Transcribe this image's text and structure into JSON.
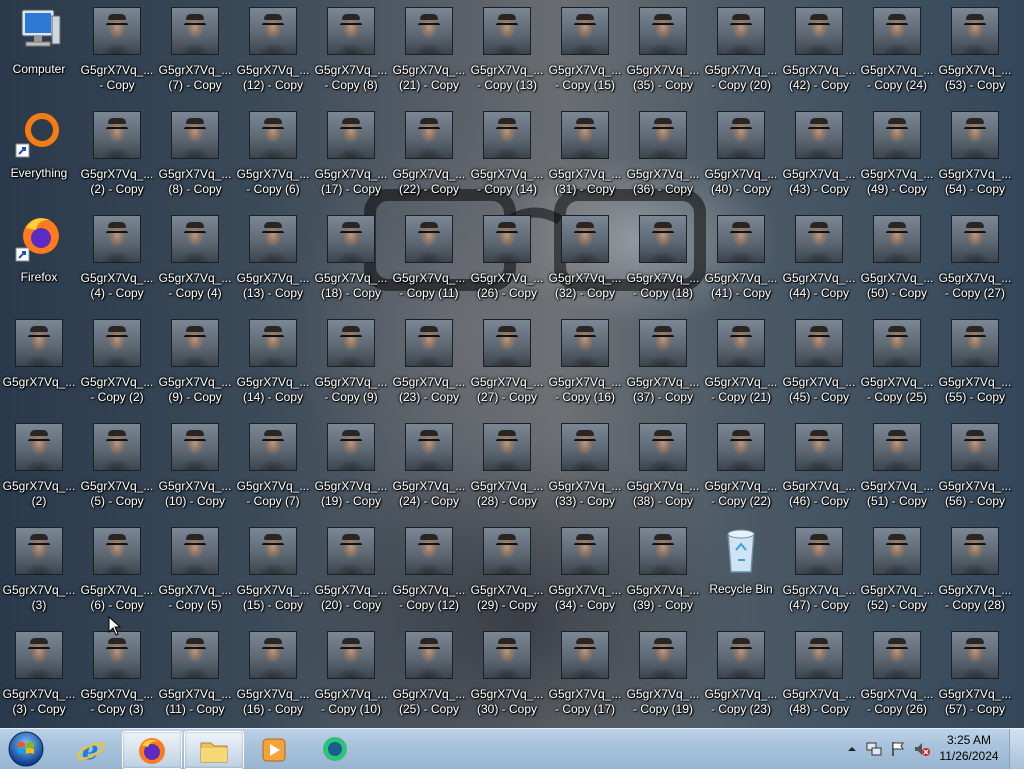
{
  "desktop": {
    "system_icons": [
      {
        "name": "computer",
        "label": "Computer",
        "col": 0,
        "row": 0
      },
      {
        "name": "everything",
        "label": "Everything",
        "col": 0,
        "row": 1
      },
      {
        "name": "firefox",
        "label": "Firefox",
        "col": 0,
        "row": 2
      },
      {
        "name": "recycle-bin",
        "label": "Recycle Bin",
        "col": 9,
        "row": 5
      }
    ],
    "file_icons": [
      {
        "col": 1,
        "row": 0,
        "l1": "G5grX7Vq_...",
        "l2": "- Copy"
      },
      {
        "col": 2,
        "row": 0,
        "l1": "G5grX7Vq_...",
        "l2": "(7) - Copy"
      },
      {
        "col": 3,
        "row": 0,
        "l1": "G5grX7Vq_...",
        "l2": "(12) - Copy"
      },
      {
        "col": 4,
        "row": 0,
        "l1": "G5grX7Vq_...",
        "l2": "- Copy (8)"
      },
      {
        "col": 5,
        "row": 0,
        "l1": "G5grX7Vq_...",
        "l2": "(21) - Copy"
      },
      {
        "col": 6,
        "row": 0,
        "l1": "G5grX7Vq_...",
        "l2": "- Copy (13)"
      },
      {
        "col": 7,
        "row": 0,
        "l1": "G5grX7Vq_...",
        "l2": "- Copy (15)"
      },
      {
        "col": 8,
        "row": 0,
        "l1": "G5grX7Vq_...",
        "l2": "(35) - Copy"
      },
      {
        "col": 9,
        "row": 0,
        "l1": "G5grX7Vq_...",
        "l2": "- Copy (20)"
      },
      {
        "col": 10,
        "row": 0,
        "l1": "G5grX7Vq_...",
        "l2": "(42) - Copy"
      },
      {
        "col": 11,
        "row": 0,
        "l1": "G5grX7Vq_...",
        "l2": "- Copy (24)"
      },
      {
        "col": 12,
        "row": 0,
        "l1": "G5grX7Vq_...",
        "l2": "(53) - Copy"
      },
      {
        "col": 1,
        "row": 1,
        "l1": "G5grX7Vq_...",
        "l2": "(2) - Copy"
      },
      {
        "col": 2,
        "row": 1,
        "l1": "G5grX7Vq_...",
        "l2": "(8) - Copy"
      },
      {
        "col": 3,
        "row": 1,
        "l1": "G5grX7Vq_...",
        "l2": "- Copy (6)"
      },
      {
        "col": 4,
        "row": 1,
        "l1": "G5grX7Vq_...",
        "l2": "(17) - Copy"
      },
      {
        "col": 5,
        "row": 1,
        "l1": "G5grX7Vq_...",
        "l2": "(22) - Copy"
      },
      {
        "col": 6,
        "row": 1,
        "l1": "G5grX7Vq_...",
        "l2": "- Copy (14)"
      },
      {
        "col": 7,
        "row": 1,
        "l1": "G5grX7Vq_...",
        "l2": "(31) - Copy"
      },
      {
        "col": 8,
        "row": 1,
        "l1": "G5grX7Vq_...",
        "l2": "(36) - Copy"
      },
      {
        "col": 9,
        "row": 1,
        "l1": "G5grX7Vq_...",
        "l2": "(40) - Copy"
      },
      {
        "col": 10,
        "row": 1,
        "l1": "G5grX7Vq_...",
        "l2": "(43) - Copy"
      },
      {
        "col": 11,
        "row": 1,
        "l1": "G5grX7Vq_...",
        "l2": "(49) - Copy"
      },
      {
        "col": 12,
        "row": 1,
        "l1": "G5grX7Vq_...",
        "l2": "(54) - Copy"
      },
      {
        "col": 1,
        "row": 2,
        "l1": "G5grX7Vq_...",
        "l2": "(4) - Copy"
      },
      {
        "col": 2,
        "row": 2,
        "l1": "G5grX7Vq_...",
        "l2": "- Copy (4)"
      },
      {
        "col": 3,
        "row": 2,
        "l1": "G5grX7Vq_...",
        "l2": "(13) - Copy"
      },
      {
        "col": 4,
        "row": 2,
        "l1": "G5grX7Vq_...",
        "l2": "(18) - Copy"
      },
      {
        "col": 5,
        "row": 2,
        "l1": "G5grX7Vq_...",
        "l2": "- Copy (11)"
      },
      {
        "col": 6,
        "row": 2,
        "l1": "G5grX7Vq_...",
        "l2": "(26) - Copy"
      },
      {
        "col": 7,
        "row": 2,
        "l1": "G5grX7Vq_...",
        "l2": "(32) - Copy"
      },
      {
        "col": 8,
        "row": 2,
        "l1": "G5grX7Vq_...",
        "l2": "- Copy (18)"
      },
      {
        "col": 9,
        "row": 2,
        "l1": "G5grX7Vq_...",
        "l2": "(41) - Copy"
      },
      {
        "col": 10,
        "row": 2,
        "l1": "G5grX7Vq_...",
        "l2": "(44) - Copy"
      },
      {
        "col": 11,
        "row": 2,
        "l1": "G5grX7Vq_...",
        "l2": "(50) - Copy"
      },
      {
        "col": 12,
        "row": 2,
        "l1": "G5grX7Vq_...",
        "l2": "- Copy (27)"
      },
      {
        "col": 0,
        "row": 3,
        "l1": "G5grX7Vq_...",
        "l2": ""
      },
      {
        "col": 1,
        "row": 3,
        "l1": "G5grX7Vq_...",
        "l2": "- Copy (2)"
      },
      {
        "col": 2,
        "row": 3,
        "l1": "G5grX7Vq_...",
        "l2": "(9) - Copy"
      },
      {
        "col": 3,
        "row": 3,
        "l1": "G5grX7Vq_...",
        "l2": "(14) - Copy"
      },
      {
        "col": 4,
        "row": 3,
        "l1": "G5grX7Vq_...",
        "l2": "- Copy (9)"
      },
      {
        "col": 5,
        "row": 3,
        "l1": "G5grX7Vq_...",
        "l2": "(23) - Copy"
      },
      {
        "col": 6,
        "row": 3,
        "l1": "G5grX7Vq_...",
        "l2": "(27) - Copy"
      },
      {
        "col": 7,
        "row": 3,
        "l1": "G5grX7Vq_...",
        "l2": "- Copy (16)"
      },
      {
        "col": 8,
        "row": 3,
        "l1": "G5grX7Vq_...",
        "l2": "(37) - Copy"
      },
      {
        "col": 9,
        "row": 3,
        "l1": "G5grX7Vq_...",
        "l2": "- Copy (21)"
      },
      {
        "col": 10,
        "row": 3,
        "l1": "G5grX7Vq_...",
        "l2": "(45) - Copy"
      },
      {
        "col": 11,
        "row": 3,
        "l1": "G5grX7Vq_...",
        "l2": "- Copy (25)"
      },
      {
        "col": 12,
        "row": 3,
        "l1": "G5grX7Vq_...",
        "l2": "(55) - Copy"
      },
      {
        "col": 0,
        "row": 4,
        "l1": "G5grX7Vq_...",
        "l2": "(2)"
      },
      {
        "col": 1,
        "row": 4,
        "l1": "G5grX7Vq_...",
        "l2": "(5) - Copy"
      },
      {
        "col": 2,
        "row": 4,
        "l1": "G5grX7Vq_...",
        "l2": "(10) - Copy"
      },
      {
        "col": 3,
        "row": 4,
        "l1": "G5grX7Vq_...",
        "l2": "- Copy (7)"
      },
      {
        "col": 4,
        "row": 4,
        "l1": "G5grX7Vq_...",
        "l2": "(19) - Copy"
      },
      {
        "col": 5,
        "row": 4,
        "l1": "G5grX7Vq_...",
        "l2": "(24) - Copy"
      },
      {
        "col": 6,
        "row": 4,
        "l1": "G5grX7Vq_...",
        "l2": "(28) - Copy"
      },
      {
        "col": 7,
        "row": 4,
        "l1": "G5grX7Vq_...",
        "l2": "(33) - Copy"
      },
      {
        "col": 8,
        "row": 4,
        "l1": "G5grX7Vq_...",
        "l2": "(38) - Copy"
      },
      {
        "col": 9,
        "row": 4,
        "l1": "G5grX7Vq_...",
        "l2": "- Copy (22)"
      },
      {
        "col": 10,
        "row": 4,
        "l1": "G5grX7Vq_...",
        "l2": "(46) - Copy"
      },
      {
        "col": 11,
        "row": 4,
        "l1": "G5grX7Vq_...",
        "l2": "(51) - Copy"
      },
      {
        "col": 12,
        "row": 4,
        "l1": "G5grX7Vq_...",
        "l2": "(56) - Copy"
      },
      {
        "col": 0,
        "row": 5,
        "l1": "G5grX7Vq_...",
        "l2": "(3)"
      },
      {
        "col": 1,
        "row": 5,
        "l1": "G5grX7Vq_...",
        "l2": "(6) - Copy"
      },
      {
        "col": 2,
        "row": 5,
        "l1": "G5grX7Vq_...",
        "l2": "- Copy (5)"
      },
      {
        "col": 3,
        "row": 5,
        "l1": "G5grX7Vq_...",
        "l2": "(15) - Copy"
      },
      {
        "col": 4,
        "row": 5,
        "l1": "G5grX7Vq_...",
        "l2": "(20) - Copy"
      },
      {
        "col": 5,
        "row": 5,
        "l1": "G5grX7Vq_...",
        "l2": "- Copy (12)"
      },
      {
        "col": 6,
        "row": 5,
        "l1": "G5grX7Vq_...",
        "l2": "(29) - Copy"
      },
      {
        "col": 7,
        "row": 5,
        "l1": "G5grX7Vq_...",
        "l2": "(34) - Copy"
      },
      {
        "col": 8,
        "row": 5,
        "l1": "G5grX7Vq_...",
        "l2": "(39) - Copy"
      },
      {
        "col": 10,
        "row": 5,
        "l1": "G5grX7Vq_...",
        "l2": "(47) - Copy"
      },
      {
        "col": 11,
        "row": 5,
        "l1": "G5grX7Vq_...",
        "l2": "(52) - Copy"
      },
      {
        "col": 12,
        "row": 5,
        "l1": "G5grX7Vq_...",
        "l2": "- Copy (28)"
      },
      {
        "col": 0,
        "row": 6,
        "l1": "G5grX7Vq_...",
        "l2": "(3) - Copy"
      },
      {
        "col": 1,
        "row": 6,
        "l1": "G5grX7Vq_...",
        "l2": "- Copy (3)"
      },
      {
        "col": 2,
        "row": 6,
        "l1": "G5grX7Vq_...",
        "l2": "(11) - Copy"
      },
      {
        "col": 3,
        "row": 6,
        "l1": "G5grX7Vq_...",
        "l2": "(16) - Copy"
      },
      {
        "col": 4,
        "row": 6,
        "l1": "G5grX7Vq_...",
        "l2": "- Copy (10)"
      },
      {
        "col": 5,
        "row": 6,
        "l1": "G5grX7Vq_...",
        "l2": "(25) - Copy"
      },
      {
        "col": 6,
        "row": 6,
        "l1": "G5grX7Vq_...",
        "l2": "(30) - Copy"
      },
      {
        "col": 7,
        "row": 6,
        "l1": "G5grX7Vq_...",
        "l2": "- Copy (17)"
      },
      {
        "col": 8,
        "row": 6,
        "l1": "G5grX7Vq_...",
        "l2": "- Copy (19)"
      },
      {
        "col": 9,
        "row": 6,
        "l1": "G5grX7Vq_...",
        "l2": "- Copy (23)"
      },
      {
        "col": 10,
        "row": 6,
        "l1": "G5grX7Vq_...",
        "l2": "(48) - Copy"
      },
      {
        "col": 11,
        "row": 6,
        "l1": "G5grX7Vq_...",
        "l2": "- Copy (26)"
      },
      {
        "col": 12,
        "row": 6,
        "l1": "G5grX7Vq_...",
        "l2": "(57) - Copy"
      }
    ]
  },
  "taskbar": {
    "pinned": [
      {
        "name": "internet-explorer",
        "active": false
      },
      {
        "name": "firefox",
        "active": true
      },
      {
        "name": "file-explorer",
        "active": true
      },
      {
        "name": "media-player",
        "active": false
      },
      {
        "name": "green-chat-app",
        "active": false
      }
    ],
    "tray_icons": [
      "show-hidden-icons",
      "network-icon",
      "action-center-flag-icon",
      "volume-muted-icon"
    ],
    "clock": {
      "time": "3:25 AM",
      "date": "11/26/2024"
    }
  },
  "colors": {
    "taskbar": "#a9c3dc",
    "label_text": "#ffffff",
    "start_orb": "#1e6fd0"
  }
}
